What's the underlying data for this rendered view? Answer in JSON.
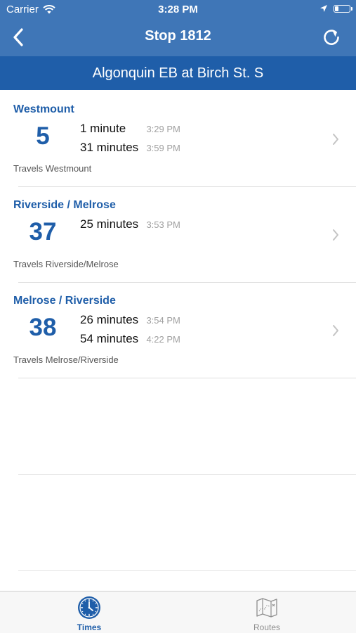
{
  "colors": {
    "header_bg": "#3f76b7",
    "stop_bar_bg": "#1f5ea9",
    "accent": "#1f5ea9",
    "tab_inactive": "#8e8e8e"
  },
  "status_bar": {
    "carrier": "Carrier",
    "time": "3:28 PM",
    "icons": [
      "wifi-icon",
      "location-arrow-icon",
      "battery-icon"
    ],
    "battery_level": 0.25
  },
  "nav": {
    "title": "Stop 1812",
    "back_icon": "chevron-left-icon",
    "refresh_icon": "refresh-icon"
  },
  "stop": {
    "name": "Algonquin EB at Birch St. S"
  },
  "routes": [
    {
      "name": "Westmount",
      "number": "5",
      "arrivals": [
        {
          "countdown": "1 minute",
          "clock": "3:29 PM"
        },
        {
          "countdown": "31 minutes",
          "clock": "3:59 PM"
        }
      ],
      "travels": "Travels Westmount"
    },
    {
      "name": "Riverside / Melrose",
      "number": "37",
      "arrivals": [
        {
          "countdown": "25 minutes",
          "clock": "3:53 PM"
        }
      ],
      "travels": "Travels Riverside/Melrose"
    },
    {
      "name": "Melrose / Riverside",
      "number": "38",
      "arrivals": [
        {
          "countdown": "26 minutes",
          "clock": "3:54 PM"
        },
        {
          "countdown": "54 minutes",
          "clock": "4:22 PM"
        }
      ],
      "travels": "Travels Melrose/Riverside"
    }
  ],
  "tabs": [
    {
      "label": "Times",
      "icon": "clock-icon",
      "active": true
    },
    {
      "label": "Routes",
      "icon": "map-icon",
      "active": false
    }
  ]
}
